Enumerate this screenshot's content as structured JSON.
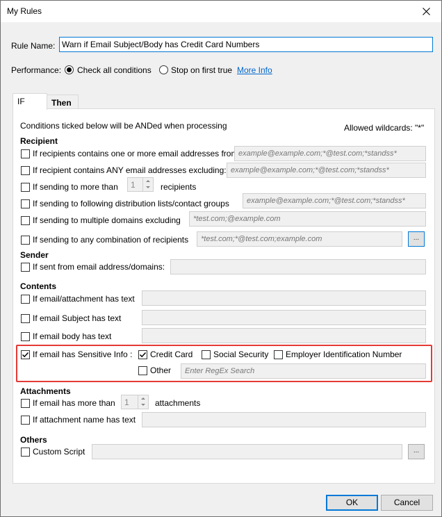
{
  "window": {
    "title": "My Rules"
  },
  "rule_name": {
    "label": "Rule Name:",
    "value": "Warn if Email Subject/Body has Credit Card Numbers"
  },
  "performance": {
    "label": "Performance:",
    "option_all": "Check all conditions",
    "option_first": "Stop on first true",
    "more_info": "More Info",
    "selected": "all"
  },
  "tabs": [
    {
      "label": "IF",
      "active": true
    },
    {
      "label": "Then",
      "active": false
    }
  ],
  "if_panel": {
    "intro": "Conditions ticked below will be ANDed when processing",
    "wildcards": "Allowed wildcards: \"*\"",
    "recipient": {
      "title": "Recipient",
      "contains_label": "If recipients contains one or more email addresses from:",
      "contains_placeholder": "example@example.com;*@test.com;*standss*",
      "excluding_label": "If recipient contains ANY email addresses excluding:",
      "excluding_placeholder": "example@example.com;*@test.com;*standss*",
      "more_than_label": "If sending to more than",
      "more_than_value": "1",
      "more_than_suffix": "recipients",
      "dist_label": "If sending to following distribution lists/contact groups",
      "dist_placeholder": "example@example.com;*@test.com;*standss*",
      "domains_label": "If sending to multiple domains excluding",
      "domains_placeholder": "*test.com;@example.com",
      "combo_label": "If sending to any combination of recipients",
      "combo_placeholder": "*test.com;*@test.com;example.com",
      "combo_button": "..."
    },
    "sender": {
      "title": "Sender",
      "from_label": "If sent from email address/domains:"
    },
    "contents": {
      "title": "Contents",
      "attachment_text_label": "If email/attachment has text",
      "subject_label": "If email Subject has text",
      "body_label": "If email body has text",
      "sensitive_label": "If email has Sensitive Info :",
      "sensitive_checked": true,
      "credit_card": "Credit Card",
      "credit_card_checked": true,
      "ssn": "Social Security",
      "ein": "Employer Identification Number",
      "other": "Other",
      "regex_placeholder": "Enter RegEx Search"
    },
    "attachments": {
      "title": "Attachments",
      "more_than_label": "If email has more than",
      "more_than_value": "1",
      "more_than_suffix": "attachments",
      "name_label": "If attachment name has text"
    },
    "others": {
      "title": "Others",
      "script_label": "Custom Script",
      "script_button": "..."
    }
  },
  "footer": {
    "ok": "OK",
    "cancel": "Cancel"
  },
  "colors": {
    "highlight": "#e53935",
    "accent": "#0078d7",
    "link": "#0066cc"
  }
}
